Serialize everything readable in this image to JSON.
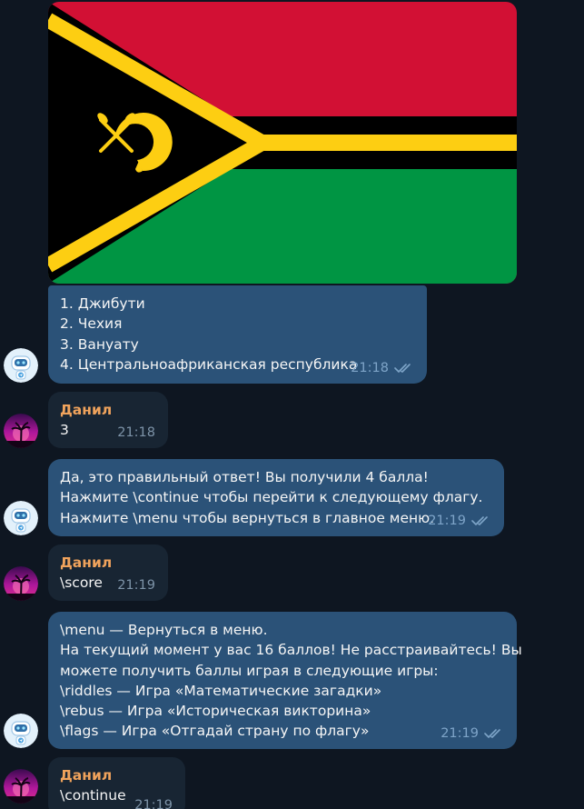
{
  "colors": {
    "background": "#0e1621",
    "incoming_bubble": "#182533",
    "bot_bubble": "#2b5278",
    "sender_name": "#f0a35c",
    "time_text": "#7ea4c8",
    "flag_red": "#d21034",
    "flag_green": "#009543",
    "flag_black": "#000000",
    "flag_yellow": "#fdce12"
  },
  "messages": [
    {
      "lines": [
        "1. Джибути",
        "2. Чехия",
        "3. Вануату",
        "4. Центральноафриканская республика"
      ],
      "time": "21:18",
      "read_icon": "double-check-icon"
    },
    {
      "sender": "Данил",
      "lines": [
        "3"
      ],
      "time": "21:18"
    },
    {
      "lines": [
        "Да, это правильный ответ! Вы получили 4 балла!",
        "Нажмите \\continue чтобы перейти к следующему флагу.",
        "Нажмите \\menu чтобы вернуться в главное меню."
      ],
      "time": "21:19",
      "read_icon": "double-check-icon"
    },
    {
      "sender": "Данил",
      "lines": [
        "\\score"
      ],
      "time": "21:19"
    },
    {
      "lines": [
        "\\menu — Вернуться в меню.",
        "На текущий момент у вас 16 баллов! Не расстраивайтесь! Вы",
        "можете получить баллы играя в следующие игры:",
        "\\riddles — Игра «Математические загадки»",
        "\\rebus — Игра «Историческая викторина»",
        "\\flags — Игра «Отгадай страну по флагу»"
      ],
      "time": "21:19",
      "read_icon": "double-check-icon"
    },
    {
      "sender": "Данил",
      "lines": [
        "\\continue"
      ],
      "time": "21:19"
    }
  ]
}
